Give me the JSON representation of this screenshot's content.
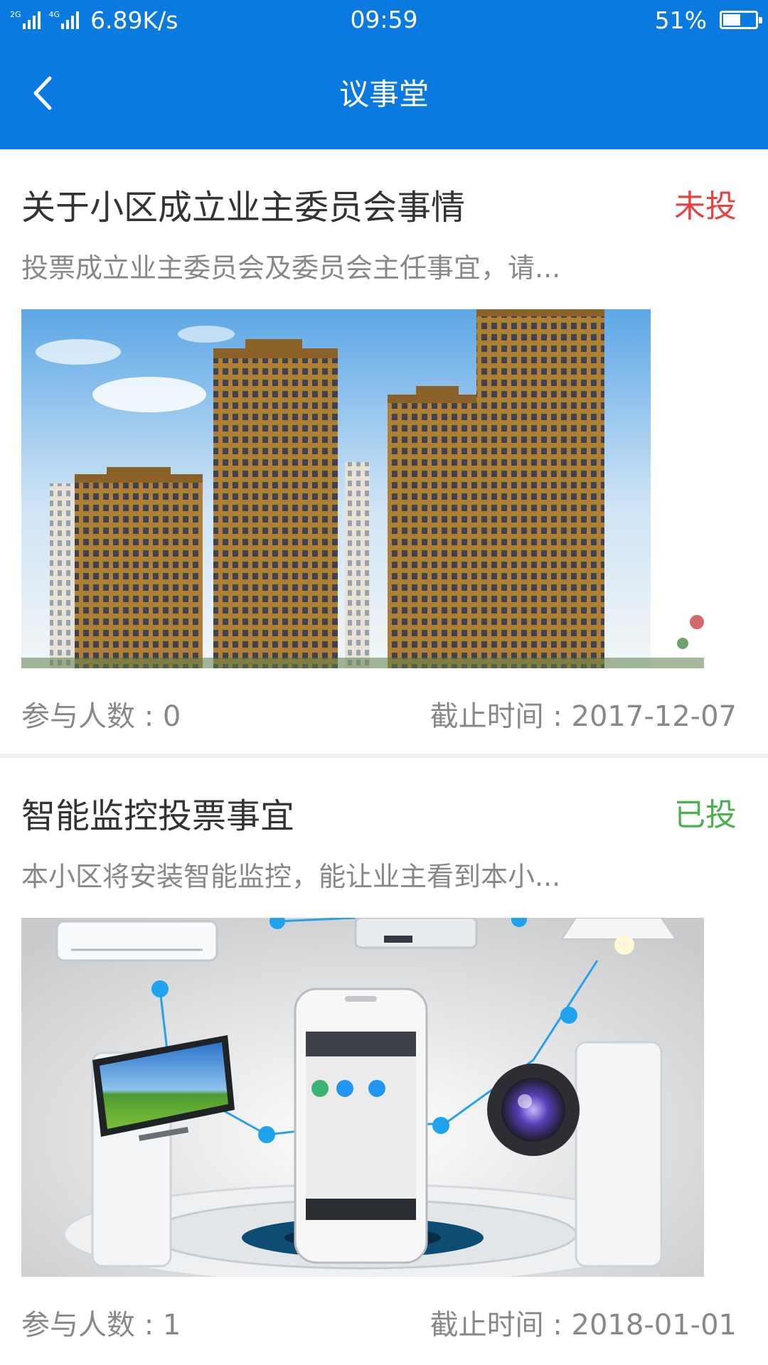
{
  "status_bar": {
    "signal_1": "2G",
    "signal_2": "4G",
    "net_speed": "6.89K/s",
    "time": "09:59",
    "battery": "51%",
    "battery_level": 0.51
  },
  "header": {
    "title": "议事堂",
    "back_icon": "chevron-left-icon",
    "background": "#0a7ae0"
  },
  "cards": [
    {
      "title": "关于小区成立业主委员会事情",
      "status": "未投",
      "status_color": "#e84343",
      "description": "投票成立业主委员会及委员会主任事宜，请...",
      "participants_label": "参与人数 : ",
      "participants": "0",
      "deadline_label": "截止时间 : ",
      "deadline": "2017-12-07"
    },
    {
      "title": "智能监控投票事宜",
      "status": "已投",
      "status_color": "#4caf50",
      "description": "本小区将安装智能监控，能让业主看到本小...",
      "participants_label": "参与人数 : ",
      "participants": "1",
      "deadline_label": "截止时间 : ",
      "deadline": "2018-01-01"
    }
  ]
}
